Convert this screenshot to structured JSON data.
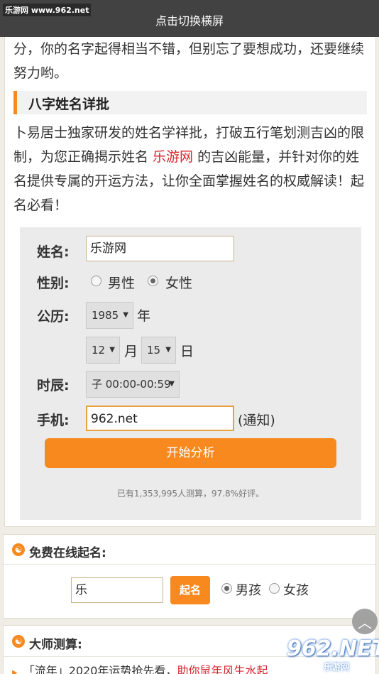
{
  "topbar": {
    "site_label": "乐游网 www.962.net",
    "title": "点击切换横屏"
  },
  "intro": {
    "text": "分，你的名字起得相当不错，但别忘了要想成功，还要继续努力哟。"
  },
  "section": {
    "title": "八字姓名详批"
  },
  "description": {
    "part1": "卜易居士独家研发的姓名学祥批，打破五行笔划测吉凶的限制，为您正确揭示姓名 ",
    "highlight": "乐游网",
    "part2": " 的吉凶能量，并针对你的姓名提供专属的开运方法，让你全面掌握姓名的权威解读！起名必看！"
  },
  "form": {
    "name_label": "姓名:",
    "name_value": "乐游网",
    "gender_label": "性别:",
    "gender_male": "男性",
    "gender_female": "女性",
    "gender_selected": "女性",
    "calendar_label": "公历:",
    "year": "1985",
    "year_unit": "年",
    "month": "12",
    "month_unit": "月",
    "day": "15",
    "day_unit": "日",
    "hour_label": "时辰:",
    "hour": "子 00:00-00:59",
    "phone_label": "手机:",
    "phone_value": "962.net",
    "phone_note": "(通知)",
    "submit_label": "开始分析",
    "stats": "已有1,353,995人测算，97.8%好评。"
  },
  "free_naming": {
    "title": "免费在线起名:",
    "surname_value": "乐",
    "button_label": "起名",
    "boy_label": "男孩",
    "girl_label": "女孩",
    "selected": "男孩"
  },
  "master": {
    "title": "大师测算:",
    "news_prefix": "「流年」2020年运势抢先看，",
    "news_highlight": "助你鼠年风生水起"
  },
  "watermark": {
    "big": "962.NET",
    "small": "乐游网"
  },
  "icons": {
    "taiji": "taiji-icon",
    "scroll_top": "chevron-up-icon",
    "select_arrow": "triangle-down-icon"
  },
  "colors": {
    "accent": "#f7891f",
    "highlight": "#d9232e",
    "topbar": "#424242"
  }
}
